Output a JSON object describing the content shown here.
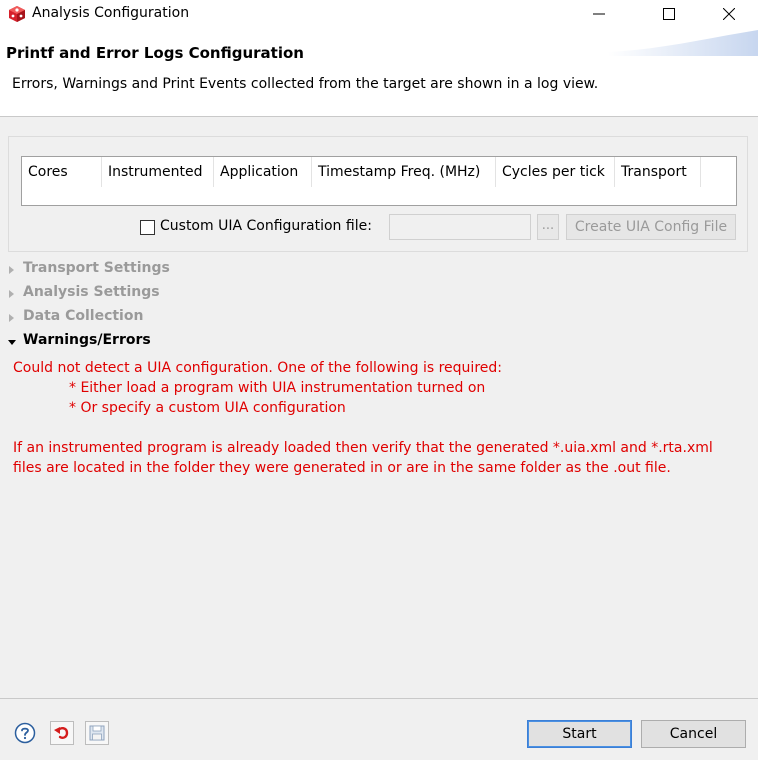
{
  "window": {
    "title": "Analysis Configuration"
  },
  "header": {
    "title": "Printf and Error Logs Configuration",
    "description": "Errors, Warnings and Print Events collected from the target are shown in a log view."
  },
  "table": {
    "columns": [
      "Cores",
      "Instrumented",
      "Application",
      "Timestamp Freq. (MHz)",
      "Cycles per tick",
      "Transport"
    ]
  },
  "uia": {
    "checkbox_label": "Custom UIA Configuration file:",
    "checked": false,
    "file_value": "",
    "browse_label": "...",
    "create_label": "Create UIA Config File"
  },
  "sections": [
    {
      "label": "Transport Settings",
      "expanded": false
    },
    {
      "label": "Analysis Settings",
      "expanded": false
    },
    {
      "label": "Data Collection",
      "expanded": false
    },
    {
      "label": "Warnings/Errors",
      "expanded": true
    }
  ],
  "errors": {
    "line1": "Could not detect a UIA configuration. One of the following is required:",
    "bullet1": "* Either load a program with UIA instrumentation turned on",
    "bullet2": "* Or specify a custom UIA configuration",
    "para1": "If an instrumented program is already loaded then verify that the generated *.uia.xml and *.rta.xml",
    "para2": "files are located in the folder they were generated in or are in the same folder as the .out file."
  },
  "buttons": {
    "start": "Start",
    "cancel": "Cancel"
  },
  "colors": {
    "error_text": "#e00000",
    "accent": "#3c7fd6",
    "app_icon": "#d6202a"
  },
  "icons": [
    "app-cube-icon",
    "minimize-icon",
    "maximize-icon",
    "close-icon",
    "chevron-right-icon",
    "chevron-down-icon",
    "help-icon",
    "revert-icon",
    "save-icon"
  ]
}
